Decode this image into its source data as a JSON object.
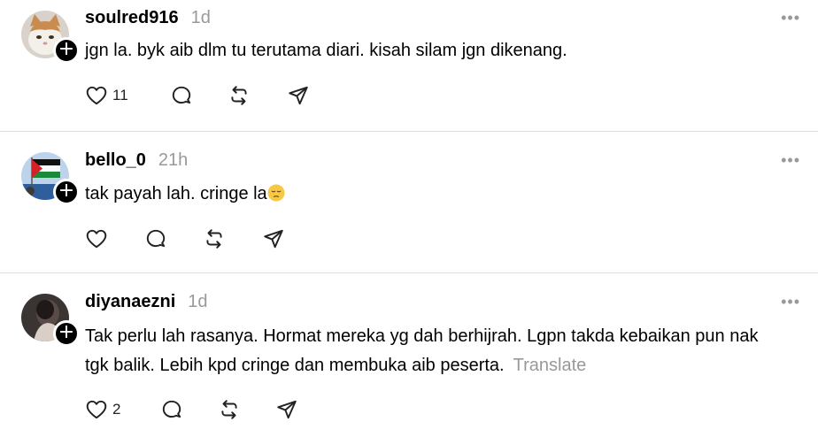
{
  "posts": [
    {
      "username": "soulred916",
      "time": "1d",
      "text": "jgn la. byk aib dlm tu terutama diari. kisah silam jgn dikenang.",
      "likes": "11",
      "avatar": "cat-photo-avatar"
    },
    {
      "username": "bello_0",
      "time": "21h",
      "text": "tak payah lah. cringe la",
      "emoji": "pensive-face-emoji",
      "likes": "",
      "avatar": "flag-photo-avatar"
    },
    {
      "username": "diyanaezni",
      "time": "1d",
      "text": "Tak perlu lah rasanya. Hormat mereka yg dah berhijrah. Lgpn takda kebaikan pun nak tgk balik. Lebih kpd cringe dan membuka aib peserta.",
      "translate": "Translate",
      "likes": "2",
      "avatar": "person-photo-avatar"
    }
  ],
  "more_label": "•••",
  "colors": {
    "secondary_text": "#999999",
    "divider": "#dedede"
  }
}
